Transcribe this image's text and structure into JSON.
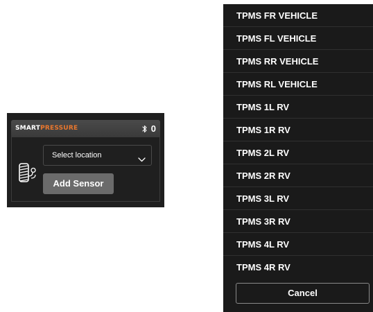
{
  "widget": {
    "brand_part1": "Smart",
    "brand_part2": "Pressure",
    "bluetooth_icon": "bluetooth-icon",
    "connected_count": "0",
    "sensor_icon": "tire-sensor-icon",
    "select": {
      "value": "Select location",
      "chevron_icon": "chevron-down-icon"
    },
    "add_sensor_label": "Add Sensor"
  },
  "location_list": {
    "options": [
      "TPMS FR VEHICLE",
      "TPMS FL VEHICLE",
      "TPMS RR VEHICLE",
      "TPMS RL VEHICLE",
      "TPMS 1L RV",
      "TPMS 1R RV",
      "TPMS 2L RV",
      "TPMS 2R RV",
      "TPMS 3L RV",
      "TPMS 3R RV",
      "TPMS 4L RV",
      "TPMS 4R RV"
    ],
    "cancel_label": "Cancel"
  },
  "colors": {
    "brand_accent": "#e8772e",
    "panel_background": "#1a1a1a",
    "widget_background": "#1f1f1f",
    "button_gray": "#6b6b6b"
  }
}
